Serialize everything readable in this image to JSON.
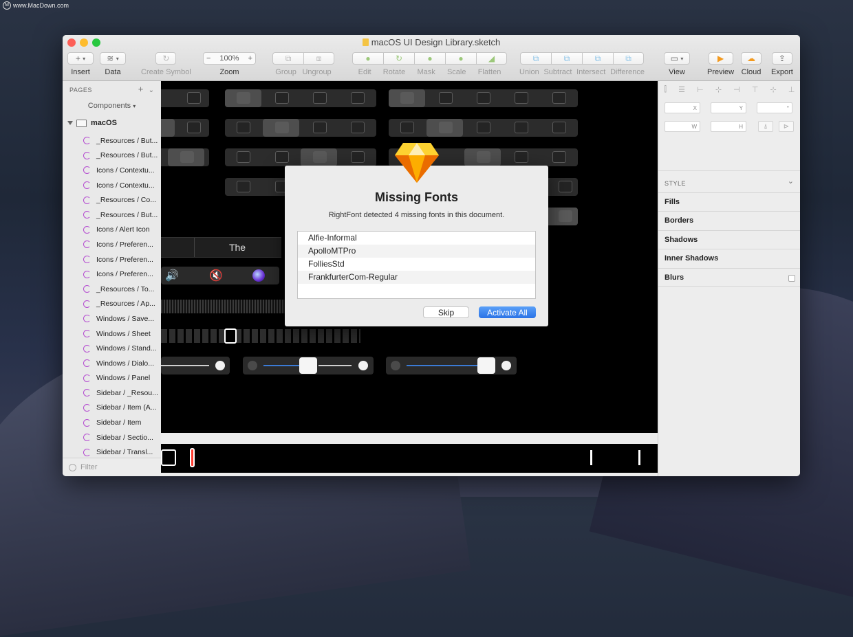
{
  "watermark": {
    "text": "www.MacDown.com"
  },
  "window": {
    "title": "macOS UI Design Library.sketch"
  },
  "toolbar": {
    "insert": "Insert",
    "data": "Data",
    "create_symbol": "Create Symbol",
    "zoom_label": "Zoom",
    "zoom_value": "100%",
    "zoom_minus": "−",
    "zoom_plus": "+",
    "group": "Group",
    "ungroup": "Ungroup",
    "edit": "Edit",
    "rotate": "Rotate",
    "mask": "Mask",
    "scale": "Scale",
    "flatten": "Flatten",
    "union": "Union",
    "subtract": "Subtract",
    "intersect": "Intersect",
    "difference": "Difference",
    "view": "View",
    "preview": "Preview",
    "cloud": "Cloud",
    "export": "Export"
  },
  "sidebar": {
    "pages_header": "PAGES",
    "page_selector": "Components",
    "page_name": "macOS",
    "layers": [
      "_Resources / But...",
      "_Resources / But...",
      "Icons / Contextu...",
      "Icons / Contextu...",
      "_Resources / Co...",
      "_Resources / But...",
      "Icons / Alert Icon",
      "Icons / Preferen...",
      "Icons / Preferen...",
      "Icons / Preferen...",
      "_Resources / To...",
      "_Resources / Ap...",
      "Windows / Save...",
      "Windows / Sheet",
      "Windows / Stand...",
      "Windows / Dialo...",
      "Windows / Panel",
      "Sidebar / _Resou...",
      "Sidebar / Item (A...",
      "Sidebar / Item",
      "Sidebar / Sectio...",
      "Sidebar / Transl..."
    ],
    "filter_placeholder": "Filter"
  },
  "canvas": {
    "segment_label": "The"
  },
  "inspector": {
    "x_label": "X",
    "y_label": "Y",
    "rot_label": "°",
    "w_label": "W",
    "h_label": "H",
    "style_header": "STYLE",
    "fills": "Fills",
    "borders": "Borders",
    "shadows": "Shadows",
    "inner_shadows": "Inner Shadows",
    "blurs": "Blurs"
  },
  "dialog": {
    "title": "Missing Fonts",
    "message": "RightFont detected 4 missing fonts in this document.",
    "fonts": [
      "Alfie-Informal",
      "ApolloMTPro",
      "FolliesStd",
      "FrankfurterCom-Regular"
    ],
    "skip": "Skip",
    "activate_all": "Activate All"
  },
  "colors": {
    "accent": "#2a72e6",
    "symbol": "#b44bd0",
    "close": "#fd5f57",
    "minimize": "#febc2e",
    "maximize": "#28c840"
  }
}
